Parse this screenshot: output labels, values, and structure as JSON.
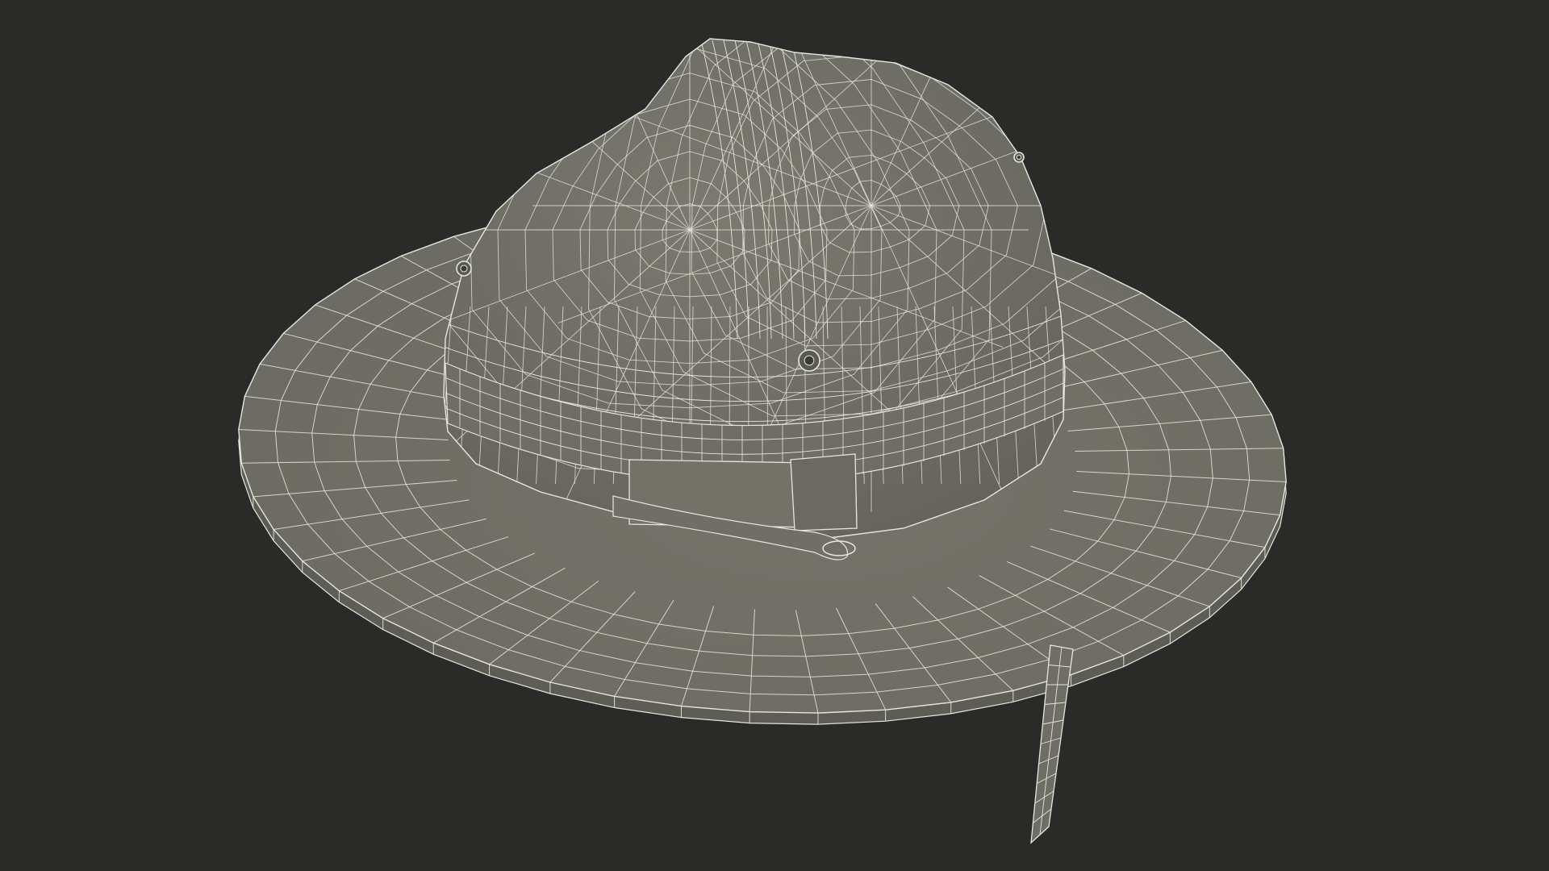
{
  "render": {
    "background_color": "#2a2a28",
    "surface_color": "#717168",
    "surface_shade_color": "#5d5d55",
    "wire_color": "#e6e6dc",
    "style": "wireframe-over-shaded",
    "subject_icon": "campaign-hat-icon"
  }
}
